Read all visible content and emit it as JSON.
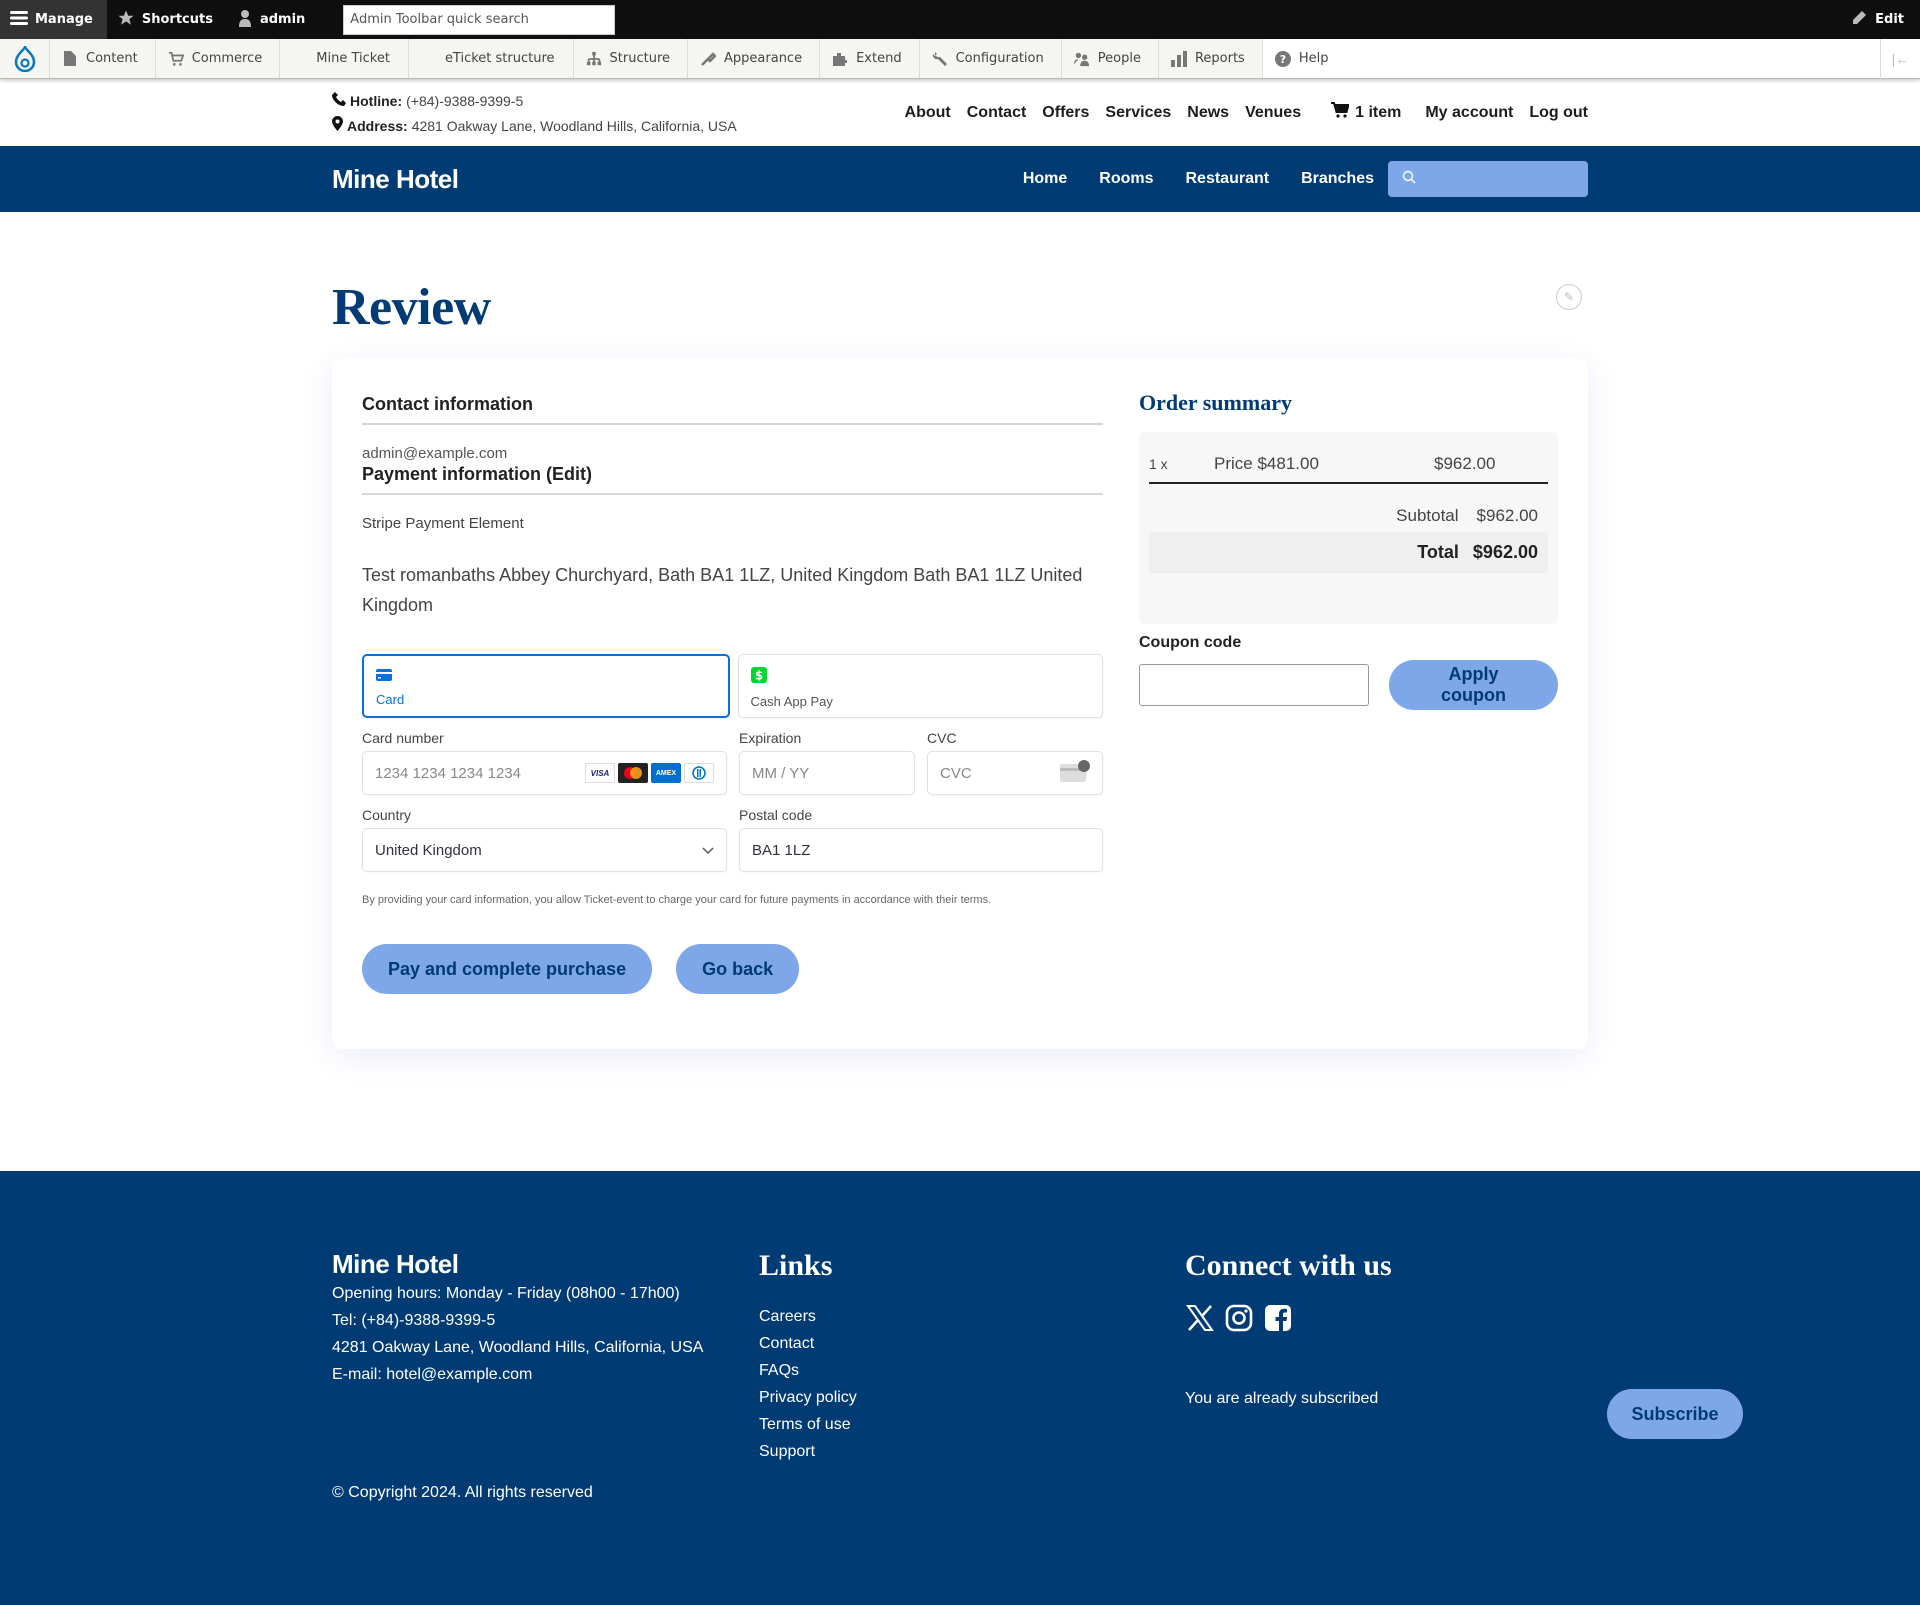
{
  "admin_toolbar": {
    "manage": "Manage",
    "shortcuts": "Shortcuts",
    "user": "admin",
    "search_placeholder": "Admin Toolbar quick search",
    "edit": "Edit"
  },
  "admin_tray": {
    "items": [
      {
        "label": "Content",
        "icon": "file-icon"
      },
      {
        "label": "Commerce",
        "icon": "cart-icon"
      },
      {
        "label": "Mine Ticket",
        "icon": ""
      },
      {
        "label": "eTicket structure",
        "icon": ""
      },
      {
        "label": "Structure",
        "icon": "sitemap-icon"
      },
      {
        "label": "Appearance",
        "icon": "brush-icon"
      },
      {
        "label": "Extend",
        "icon": "puzzle-icon"
      },
      {
        "label": "Configuration",
        "icon": "wrench-icon"
      },
      {
        "label": "People",
        "icon": "people-icon"
      },
      {
        "label": "Reports",
        "icon": "chart-icon"
      },
      {
        "label": "Help",
        "icon": "help-icon"
      }
    ]
  },
  "info_bar": {
    "hotline_label": "Hotline:",
    "hotline": "(+84)-9388-9399-5",
    "address_label": "Address:",
    "address": "4281 Oakway Lane, Woodland Hills, California, USA",
    "links": [
      "About",
      "Contact",
      "Offers",
      "Services",
      "News",
      "Venues"
    ],
    "cart": "1 item",
    "my_account": "My account",
    "log_out": "Log out"
  },
  "nav": {
    "brand": "Mine Hotel",
    "links": [
      "Home",
      "Rooms",
      "Restaurant",
      "Branches"
    ],
    "search_placeholder": ""
  },
  "page": {
    "title": "Review"
  },
  "contact": {
    "heading": "Contact information",
    "email": "admin@example.com"
  },
  "payment": {
    "heading": "Payment information (Edit)",
    "method_label": "Stripe Payment Element",
    "billing_address": "Test romanbaths Abbey Churchyard, Bath BA1 1LZ, United Kingdom Bath BA1 1LZ United Kingdom",
    "tabs": [
      {
        "label": "Card",
        "active": true
      },
      {
        "label": "Cash App Pay",
        "active": false
      }
    ],
    "card_number_label": "Card number",
    "card_number_placeholder": "1234 1234 1234 1234",
    "card_brands": [
      "VISA",
      "Mastercard",
      "AMEX",
      "Diners"
    ],
    "expiration_label": "Expiration",
    "expiration_placeholder": "MM / YY",
    "cvc_label": "CVC",
    "cvc_placeholder": "CVC",
    "country_label": "Country",
    "country_value": "United Kingdom",
    "postal_label": "Postal code",
    "postal_value": "BA1 1LZ",
    "terms": "By providing your card information, you allow Ticket-event to charge your card for future payments in accordance with their terms."
  },
  "actions": {
    "pay": "Pay and complete purchase",
    "back": "Go back"
  },
  "order_summary": {
    "title": "Order summary",
    "line": {
      "qty": "1 x",
      "description": "Price $481.00",
      "total": "$962.00"
    },
    "subtotal_label": "Subtotal",
    "subtotal": "$962.00",
    "total_label": "Total",
    "total": "$962.00",
    "coupon_label": "Coupon code",
    "coupon_value": "",
    "apply": "Apply coupon"
  },
  "footer": {
    "brand": "Mine Hotel",
    "lines": [
      "Opening hours: Monday - Friday (08h00 - 17h00)",
      "Tel: (+84)-9388-9399-5",
      "4281 Oakway Lane, Woodland Hills, California, USA",
      "E-mail: hotel@example.com"
    ],
    "links_heading": "Links",
    "links": [
      "Careers",
      "Contact",
      "FAQs",
      "Privacy policy",
      "Terms of use",
      "Support"
    ],
    "connect_heading": "Connect with us",
    "social": [
      "x-icon",
      "instagram-icon",
      "facebook-icon"
    ],
    "subscribed_text": "You are already subscribed",
    "subscribe": "Subscribe",
    "copyright": "© Copyright 2024. All rights reserved"
  },
  "colors": {
    "brand_blue": "#003b73",
    "button_blue": "#7da7e8",
    "stripe_blue": "#0570de"
  }
}
